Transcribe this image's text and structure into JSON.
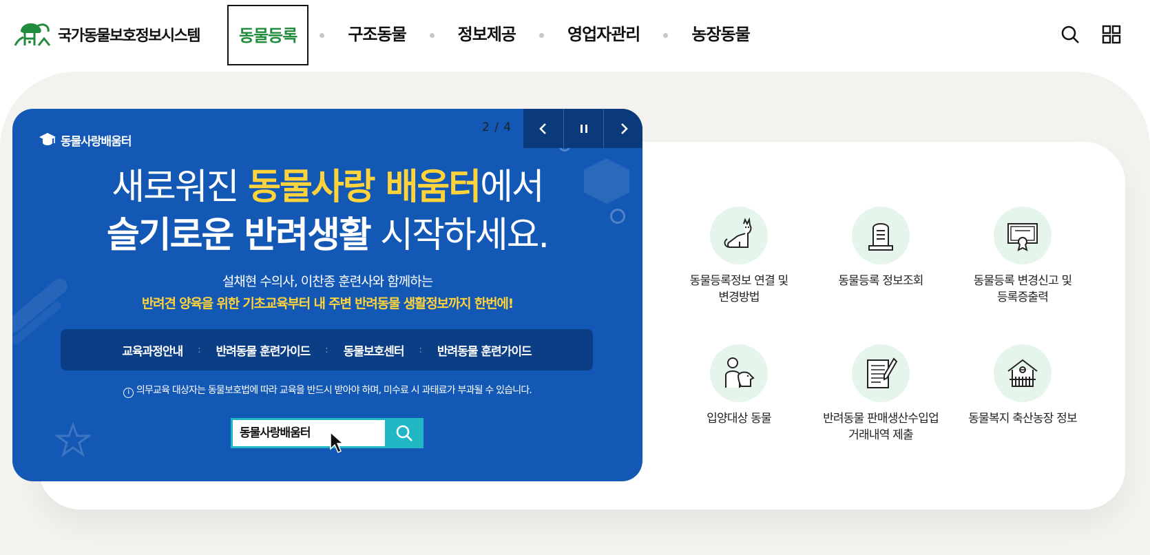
{
  "header": {
    "logo_text": "국가동물보호정보시스템",
    "nav": [
      {
        "label": "동물등록",
        "active": true
      },
      {
        "label": "구조동물",
        "active": false
      },
      {
        "label": "정보제공",
        "active": false
      },
      {
        "label": "영업자관리",
        "active": false
      },
      {
        "label": "농장동물",
        "active": false
      }
    ],
    "icons": [
      "search-icon",
      "grid-menu-icon"
    ]
  },
  "banner": {
    "brand": "동물사랑배움터",
    "counter": "2 / 4",
    "controls": [
      "prev-icon",
      "pause-icon",
      "next-icon"
    ],
    "headline1": {
      "light": "새로워진 ",
      "yellow": "동물사랑 배움터",
      "tail": "에서"
    },
    "headline2": {
      "bold": "슬기로운 반려생활",
      "tail": " 시작하세요."
    },
    "sub1": "설채현 수의사, 이찬종 훈련사와 함께하는",
    "sub2": "반려견 양육을 위한 기초교육부터 내 주변 반려동물 생활정보까지 한번에!",
    "menu": [
      "교육과정안내",
      "반려동물 훈련가이드",
      "동물보호센터",
      "반려동물 훈련가이드"
    ],
    "menu_sep": ":",
    "notice_icon": "i",
    "notice": "의무교육 대상자는 동물보호법에 따라 교육을 반드시 받아야 하며, 미수료 시 과태료가 부과될 수 있습니다.",
    "search_value": "동물사랑배움터",
    "colors": {
      "bg": "#1458b5",
      "accent": "#ffd43b",
      "search": "#20b6c4"
    }
  },
  "quick_links": [
    {
      "icon": "cat-icon",
      "line1": "동물등록정보 연결 및",
      "line2": "변경방법"
    },
    {
      "icon": "tombstone-icon",
      "line1": "동물등록 정보조회",
      "line2": ""
    },
    {
      "icon": "certificate-icon",
      "line1": "동물등록 변경신고 및",
      "line2": "등록증출력"
    },
    {
      "icon": "adoption-person-dog-icon",
      "line1": "입양대상 동물",
      "line2": ""
    },
    {
      "icon": "document-pen-icon",
      "line1": "반려동물 판매생산수입업",
      "line2": "거래내역 제출"
    },
    {
      "icon": "barn-icon",
      "line1": "동물복지 축산농장 정보",
      "line2": ""
    }
  ],
  "colors": {
    "brand_green": "#1f8b3b",
    "icon_bg": "#e6f5ec",
    "slab": "#f3f2ee"
  }
}
